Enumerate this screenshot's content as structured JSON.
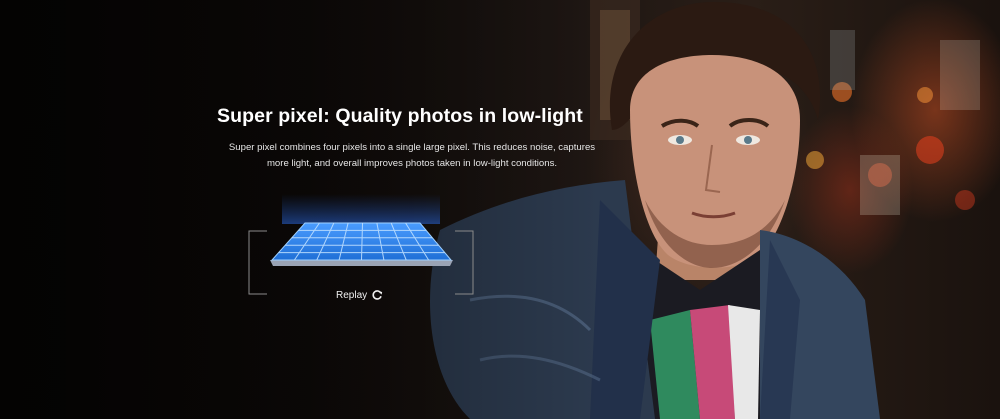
{
  "feature": {
    "headline": "Super pixel: Quality photos in low-light",
    "description": "Super pixel combines four pixels into a single large pixel. This reduces noise, captures more light, and overall improves photos taken in low-light conditions."
  },
  "replay": {
    "label": "Replay",
    "icon": "refresh-icon"
  },
  "colors": {
    "headline": "#ffffff",
    "pixel_grid": "#2f86e6",
    "pixel_grid_light": "#6fb6ff",
    "background": "#0c0908"
  }
}
